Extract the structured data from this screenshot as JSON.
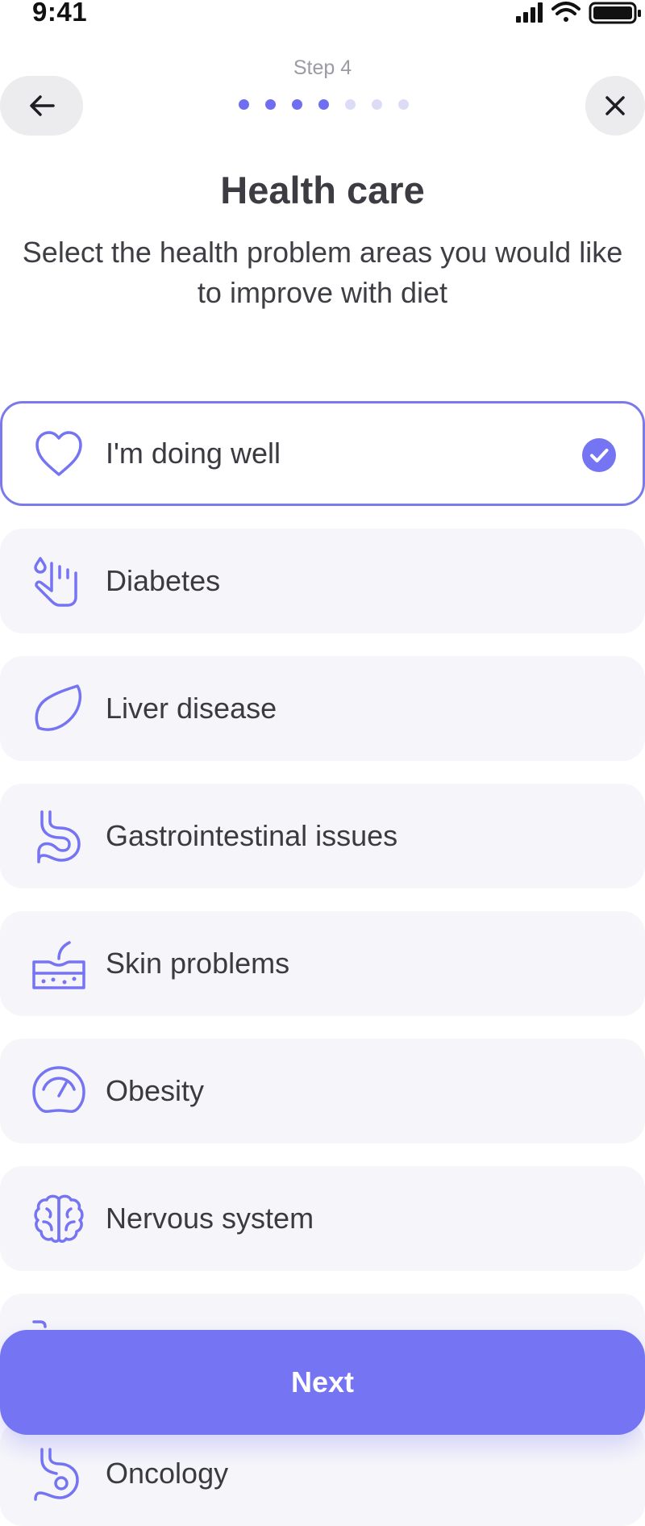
{
  "status_bar": {
    "time": "9:41"
  },
  "header": {
    "step_label": "Step 4",
    "progress_total": 7,
    "progress_current": 4
  },
  "title": "Health care",
  "subtitle": "Select the health problem areas you would like to improve with diet",
  "options": [
    {
      "label": "I'm doing well",
      "icon": "heart-icon",
      "selected": true
    },
    {
      "label": "Diabetes",
      "icon": "diabetes-icon",
      "selected": false
    },
    {
      "label": "Liver disease",
      "icon": "liver-icon",
      "selected": false
    },
    {
      "label": "Gastrointestinal issues",
      "icon": "stomach-icon",
      "selected": false
    },
    {
      "label": "Skin problems",
      "icon": "skin-icon",
      "selected": false
    },
    {
      "label": "Obesity",
      "icon": "scale-icon",
      "selected": false
    },
    {
      "label": "Nervous system",
      "icon": "brain-icon",
      "selected": false
    },
    {
      "label": "",
      "icon": "",
      "selected": false
    },
    {
      "label": "Oncology",
      "icon": "oncology-icon",
      "selected": false
    }
  ],
  "next_label": "Next",
  "colors": {
    "accent": "#7574F3",
    "option_bg": "#F6F6FA",
    "text": "#3A3A40"
  }
}
